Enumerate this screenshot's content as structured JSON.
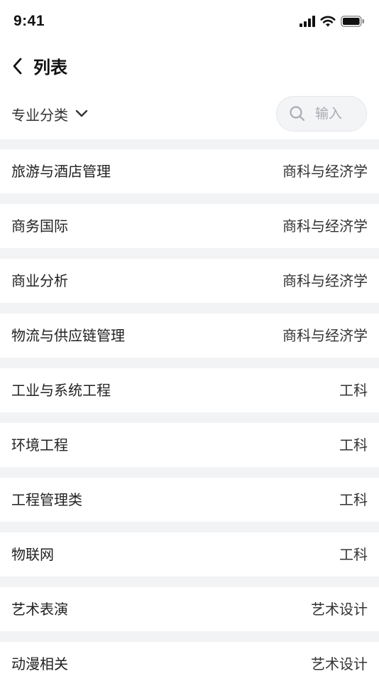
{
  "status_bar": {
    "time": "9:41",
    "icons": [
      "signal-icon",
      "wifi-icon",
      "battery-icon"
    ]
  },
  "nav": {
    "back_icon": "chevron-left-icon",
    "title": "列表"
  },
  "filter": {
    "category_label": "专业分类",
    "dropdown_icon": "chevron-down-icon",
    "search_placeholder": "输入",
    "search_value": ""
  },
  "majors": [
    {
      "name": "旅游与酒店管理",
      "category": "商科与经济学"
    },
    {
      "name": "商务国际",
      "category": "商科与经济学"
    },
    {
      "name": "商业分析",
      "category": "商科与经济学"
    },
    {
      "name": "物流与供应链管理",
      "category": "商科与经济学"
    },
    {
      "name": "工业与系统工程",
      "category": "工科"
    },
    {
      "name": "环境工程",
      "category": "工科"
    },
    {
      "name": "工程管理类",
      "category": "工科"
    },
    {
      "name": "物联网",
      "category": "工科"
    },
    {
      "name": "艺术表演",
      "category": "艺术设计"
    },
    {
      "name": "动漫相关",
      "category": "艺术设计"
    }
  ],
  "colors": {
    "background": "#f2f3f5",
    "surface": "#ffffff",
    "text_primary": "#222222",
    "placeholder": "#a8abb2"
  }
}
